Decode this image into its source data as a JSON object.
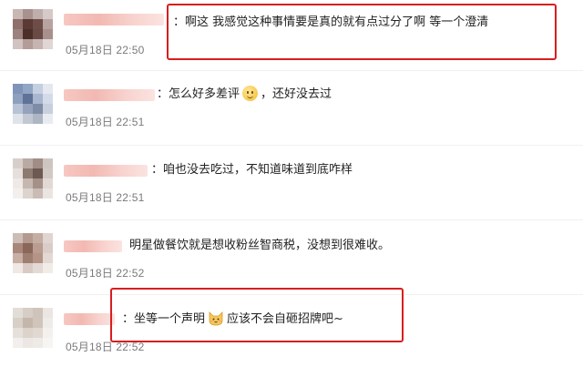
{
  "comments": [
    {
      "text": "：啊这 我感觉这种事情要是真的就有点过分了啊 等一个澄清",
      "time": "05月18日 22:50",
      "avatar_colors": [
        "#c9b7b5",
        "#a7928f",
        "#bfaeac",
        "#d6cac9",
        "#8e6f6b",
        "#5b3a35",
        "#6e4d48",
        "#b9a3a0",
        "#9b827e",
        "#4d2f2a",
        "#6a4a45",
        "#a8908c",
        "#d0c3c1",
        "#b49c98",
        "#c6b4b1",
        "#e0d6d4"
      ],
      "highlighted": true
    },
    {
      "text_before": "：怎么好多差评",
      "emoji": "grimace-emoji",
      "text_after": "，还好没去过",
      "time": "05月18日 22:51",
      "avatar_colors": [
        "#7f94b8",
        "#93a6c6",
        "#c4cfe0",
        "#e4e8f0",
        "#8ea0bf",
        "#5f7298",
        "#a9b6cf",
        "#d4dbe8",
        "#b8c3d8",
        "#95a2bb",
        "#7f8ca6",
        "#c9d0dd",
        "#dfe3ea",
        "#c2c8d3",
        "#aeb6c4",
        "#e8ebf0"
      ],
      "highlighted": false
    },
    {
      "text": "：咱也没去吃过，不知道味道到底咋样",
      "time": "05月18日 22:51",
      "avatar_colors": [
        "#d8cfcb",
        "#b9aaa4",
        "#a08e86",
        "#cfc5c0",
        "#e6dfdb",
        "#8d7a71",
        "#6c5a52",
        "#d3c9c4",
        "#efeae7",
        "#c6b8b1",
        "#a59188",
        "#e2d9d5",
        "#f3efed",
        "#ddd3cf",
        "#c9bcb6",
        "#ebe5e2"
      ],
      "highlighted": false
    },
    {
      "text": "明星做餐饮就是想收粉丝智商税，没想到很难收。",
      "time": "05月18日 22:52",
      "avatar_colors": [
        "#cdbdb7",
        "#b49a8e",
        "#c4ada3",
        "#e0d5d0",
        "#a8877a",
        "#8a6758",
        "#b99d90",
        "#dacdc7",
        "#c7afa4",
        "#9e7e70",
        "#b39486",
        "#e3d9d4",
        "#efe8e5",
        "#d9cbc4",
        "#e4dad5",
        "#f2ece9"
      ],
      "highlighted": false
    },
    {
      "text_before": "：坐等一个声明",
      "emoji": "cat-emoji",
      "text_after": "应该不会自砸招牌吧~",
      "time": "05月18日 22:52",
      "avatar_colors": [
        "#e3ddd8",
        "#d6cdc6",
        "#cfc4bc",
        "#ebe6e2",
        "#d8cfc7",
        "#c4b6ab",
        "#d1c5bb",
        "#efebe8",
        "#e6e0db",
        "#dcd3cb",
        "#e0d8d1",
        "#f3f0ed",
        "#f2efec",
        "#ece7e3",
        "#eeeae6",
        "#f7f5f3"
      ],
      "highlighted": true
    }
  ],
  "colors": {
    "highlight": "#d81e1e",
    "timestamp": "#7a7a7a",
    "name_blur": "#f2b9b2"
  }
}
